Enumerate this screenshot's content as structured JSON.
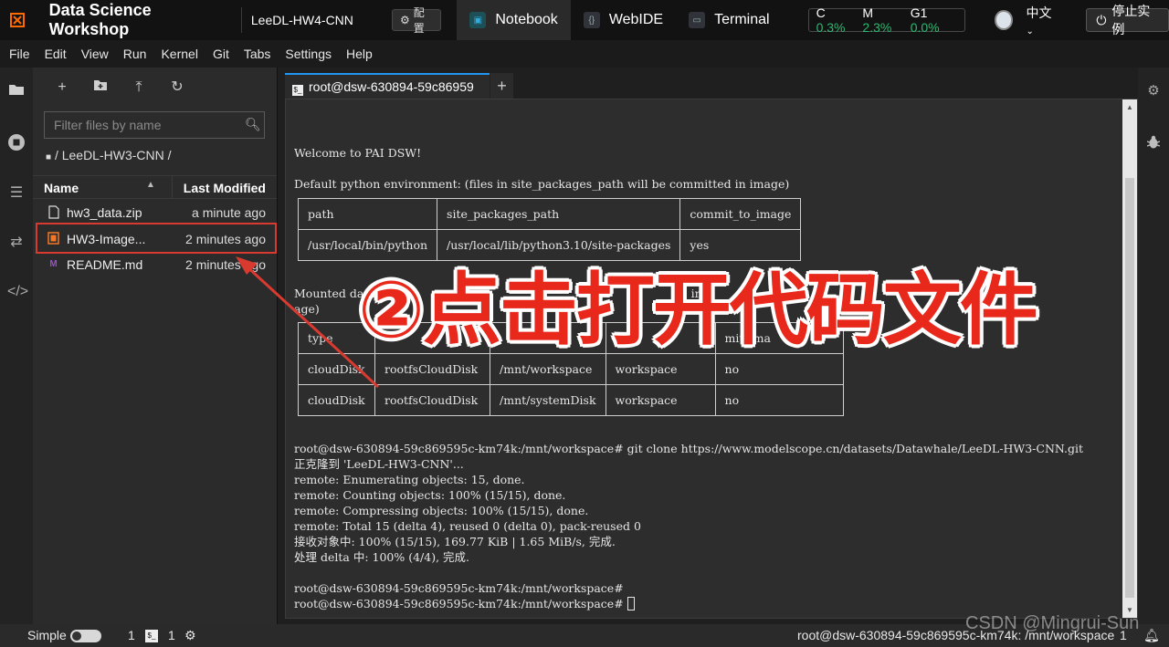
{
  "topbar": {
    "app_title": "Data Science Workshop",
    "project": "LeeDL-HW4-CNN",
    "config_label": "配置",
    "tabs": [
      {
        "label": "Notebook",
        "icon": "notebook-icon",
        "active": true
      },
      {
        "label": "WebIDE",
        "icon": "webide-icon",
        "active": false
      },
      {
        "label": "Terminal",
        "icon": "terminal-icon",
        "active": false
      }
    ],
    "resources": {
      "c_label": "C",
      "c_value": "0.3%",
      "m_label": "M",
      "m_value": "2.3%",
      "g_label": "G1",
      "g_value": "0.0%",
      "value_color": "#2eb872"
    },
    "language": "中文",
    "stop_label": "停止实例"
  },
  "menu": [
    "File",
    "Edit",
    "View",
    "Run",
    "Kernel",
    "Git",
    "Tabs",
    "Settings",
    "Help"
  ],
  "file_browser": {
    "filter_placeholder": "Filter files by name",
    "breadcrumb": "/ LeeDL-HW3-CNN /",
    "col_name": "Name",
    "col_modified": "Last Modified",
    "files": [
      {
        "name": "hw3_data.zip",
        "modified": "a minute ago",
        "icon": "file-icon"
      },
      {
        "name": "HW3-Image...",
        "modified": "2 minutes ago",
        "icon": "notebook-file-icon"
      },
      {
        "name": "README.md",
        "modified": "2 minutes ago",
        "icon": "markdown-icon"
      }
    ],
    "highlight_color": "#d93a2f"
  },
  "terminal": {
    "tab_title": "root@dsw-630894-59c86959",
    "welcome": "Welcome to PAI DSW!",
    "env_heading": "Default python environment: (files in site_packages_path will be committed in image)",
    "env_table": [
      [
        "path",
        "site_packages_path",
        "commit_to_image"
      ],
      [
        "/usr/local/bin/python",
        "/usr/local/lib/python3.10/site-packages",
        "yes"
      ]
    ],
    "mount_heading_1": "Mounted data",
    "mount_heading_1b": "t_path",
    "mount_heading_1c": "in",
    "mount_heading_1d": "t",
    "mount_heading_2": "age)",
    "mount_table": [
      [
        "type",
        "",
        "",
        "dat",
        "mit_ima"
      ],
      [
        "cloudDisk",
        "rootfsCloudDisk",
        "/mnt/workspace",
        "workspace",
        "no"
      ],
      [
        "cloudDisk",
        "rootfsCloudDisk",
        "/mnt/systemDisk",
        "workspace",
        "no"
      ]
    ],
    "lines": [
      "root@dsw-630894-59c869595c-km74k:/mnt/workspace# git clone https://www.modelscope.cn/datasets/Datawhale/LeeDL-HW3-CNN.git",
      "正克隆到 'LeeDL-HW3-CNN'...",
      "remote: Enumerating objects: 15, done.",
      "remote: Counting objects: 100% (15/15), done.",
      "remote: Compressing objects: 100% (15/15), done.",
      "remote: Total 15 (delta 4), reused 0 (delta 0), pack-reused 0",
      "接收对象中: 100% (15/15), 169.77 KiB | 1.65 MiB/s, 完成.",
      "处理 delta 中: 100% (4/4), 完成.",
      "",
      "root@dsw-630894-59c869595c-km74k:/mnt/workspace#"
    ],
    "prompt": "root@dsw-630894-59c869595c-km74k:/mnt/workspace# "
  },
  "annotation": {
    "text": "②点击打开代码文件",
    "color": "#e8281b"
  },
  "statusbar": {
    "mode": "Simple",
    "count1": "1",
    "count2": "1",
    "right_text": "root@dsw-630894-59c869595c-km74k: /mnt/workspace",
    "right_count": "1"
  },
  "watermark": "CSDN @Mingrui-Sun"
}
